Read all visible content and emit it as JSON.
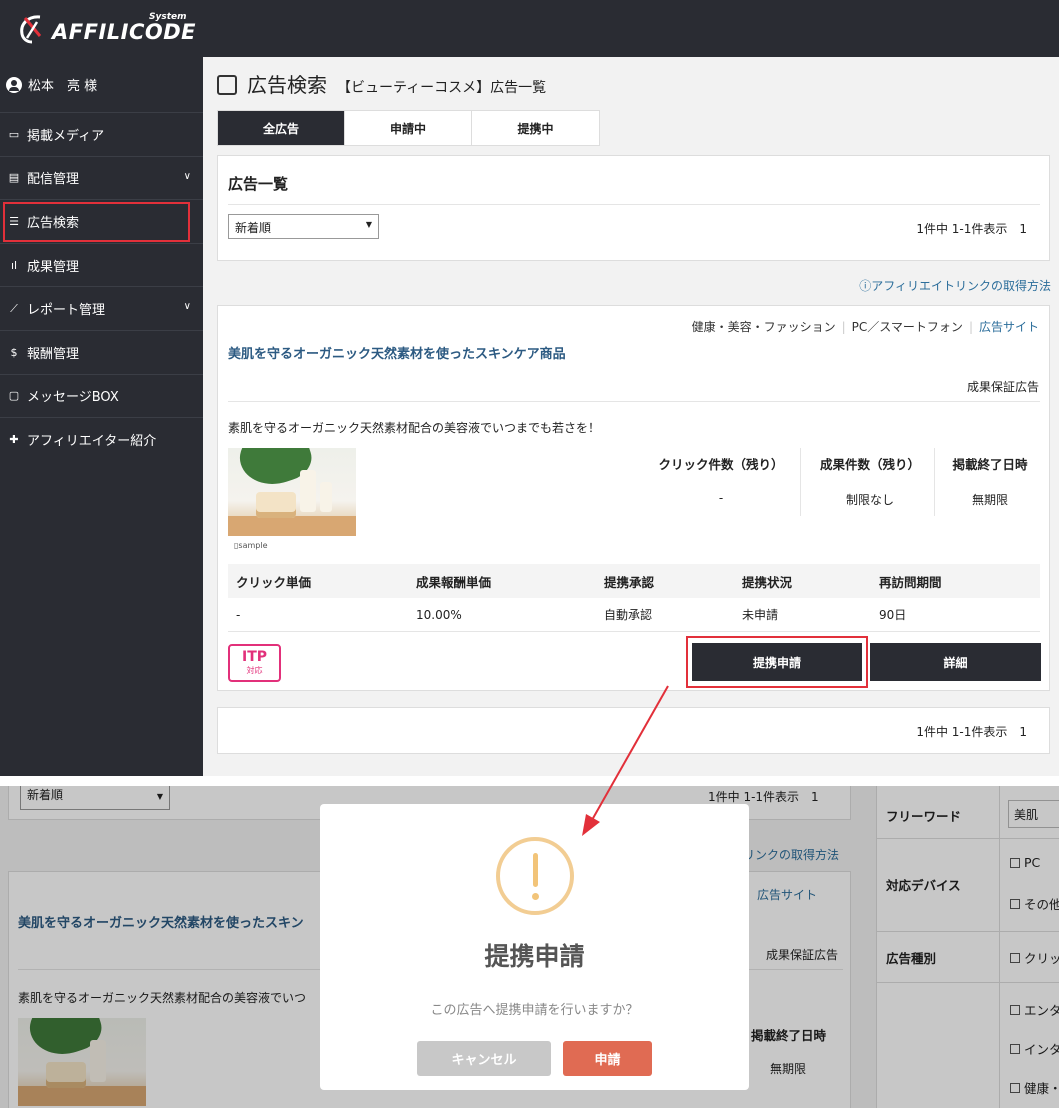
{
  "brand": {
    "name": "AFFILICODE",
    "tag": "System"
  },
  "user": {
    "name": "松本　亮 様"
  },
  "sidebar": {
    "items": [
      {
        "label": "掲載メディア",
        "icon": "media-icon",
        "has_children": false
      },
      {
        "label": "配信管理",
        "icon": "delivery-icon",
        "has_children": true
      },
      {
        "label": "広告検索",
        "icon": "list-icon",
        "has_children": false,
        "active": true
      },
      {
        "label": "成果管理",
        "icon": "bar-chart-icon",
        "has_children": false
      },
      {
        "label": "レポート管理",
        "icon": "line-chart-icon",
        "has_children": true
      },
      {
        "label": "報酬管理",
        "icon": "dollar-icon",
        "has_children": false
      },
      {
        "label": "メッセージBOX",
        "icon": "message-icon",
        "has_children": false
      },
      {
        "label": "アフィリエイター紹介",
        "icon": "user-plus-icon",
        "has_children": false
      }
    ]
  },
  "page": {
    "title": "広告検索",
    "subtitle": "【ビューティーコスメ】広告一覧"
  },
  "tabs": [
    {
      "label": "全広告",
      "active": true
    },
    {
      "label": "申請中",
      "active": false
    },
    {
      "label": "提携中",
      "active": false
    }
  ],
  "list": {
    "heading": "広告一覧",
    "sort_selected": "新着順",
    "pagination": "1件中 1-1件表示　1",
    "help_link": "アフィリエイトリンクの取得方法"
  },
  "ad": {
    "categories": [
      "健康・美容・ファッション",
      "PC／スマートフォン"
    ],
    "site_link": "広告サイト",
    "title": "美肌を守るオーガニック天然素材を使ったスキンケア商品",
    "type": "成果保証広告",
    "description": "素肌を守るオーガニック天然素材配合の美容液でいつまでも若さを！",
    "image_caption": "sample",
    "stats": [
      {
        "label": "クリック件数（残り）",
        "value": "-"
      },
      {
        "label": "成果件数（残り）",
        "value": "制限なし"
      },
      {
        "label": "掲載終了日時",
        "value": "無期限"
      }
    ],
    "table": {
      "headers": [
        "クリック単価",
        "成果報酬単価",
        "提携承認",
        "提携状況",
        "再訪問期間"
      ],
      "row": [
        "-",
        "10.00%",
        "自動承認",
        "未申請",
        "90日"
      ]
    },
    "itp_badge": {
      "line1": "ITP",
      "line2": "対応"
    },
    "apply_label": "提携申請",
    "detail_label": "詳細"
  },
  "bottom": {
    "sort_selected": "新着順",
    "pagination": "1件中 1-1件表示　1",
    "help_link_partial": "リンクの取得方法",
    "site_link": "広告サイト",
    "title_partial": "美肌を守るオーガニック天然素材を使ったスキン",
    "type": "成果保証広告",
    "desc_partial": "素肌を守るオーガニック天然素材配合の美容液でいつ",
    "end_label": "掲載終了日時",
    "end_value": "無期限"
  },
  "search_panel": {
    "freeword_label": "フリーワード",
    "freeword_value": "美肌",
    "device_label": "対応デバイス",
    "device_options": [
      "PC",
      "その他"
    ],
    "adtype_label": "広告種別",
    "adtype_options": [
      "クリッ"
    ],
    "genre_options": [
      "エンタ",
      "インタ",
      "健康・"
    ]
  },
  "modal": {
    "title": "提携申請",
    "message": "この広告へ提携申請を行いますか？",
    "cancel_label": "キャンセル",
    "ok_label": "申請",
    "warn_color": "#f2c479"
  },
  "colors": {
    "dark": "#2a2c33",
    "highlight": "#e2303a",
    "link": "#2c6e9b",
    "ok": "#e06b53"
  }
}
